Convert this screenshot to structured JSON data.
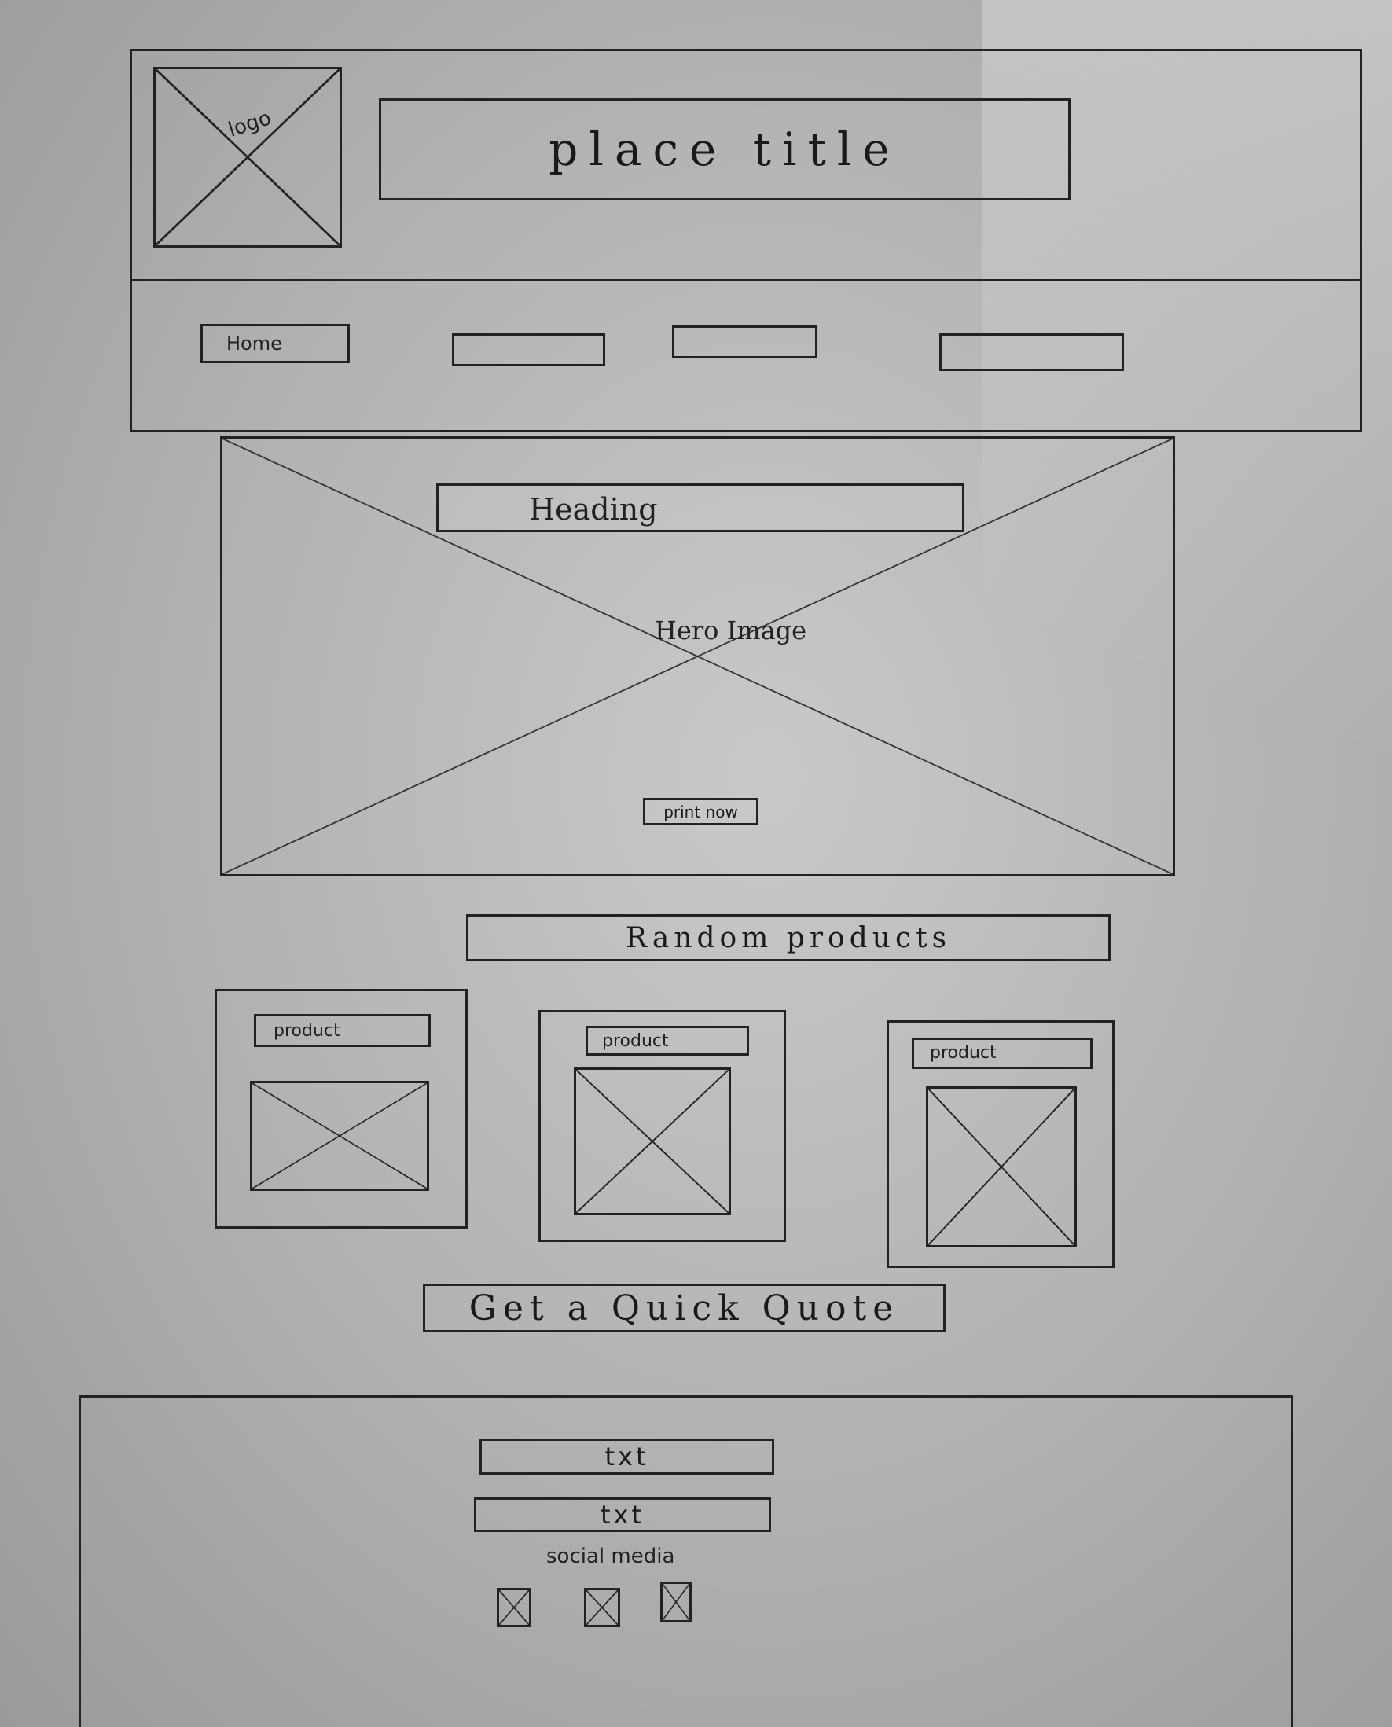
{
  "header": {
    "logo_label": "logo",
    "title": "place title",
    "nav": [
      "Home",
      "",
      "",
      ""
    ]
  },
  "hero": {
    "heading": "Heading",
    "image_label": "Hero Image",
    "cta": "print now"
  },
  "products": {
    "section_title": "Random products",
    "items": [
      {
        "label": "product"
      },
      {
        "label": "product"
      },
      {
        "label": "product"
      }
    ]
  },
  "quote_button": "Get a Quick Quote",
  "footer": {
    "lines": [
      "txt",
      "txt"
    ],
    "social_label": "social media",
    "social_icons": [
      "social-icon-1",
      "social-icon-2",
      "social-icon-3"
    ]
  }
}
